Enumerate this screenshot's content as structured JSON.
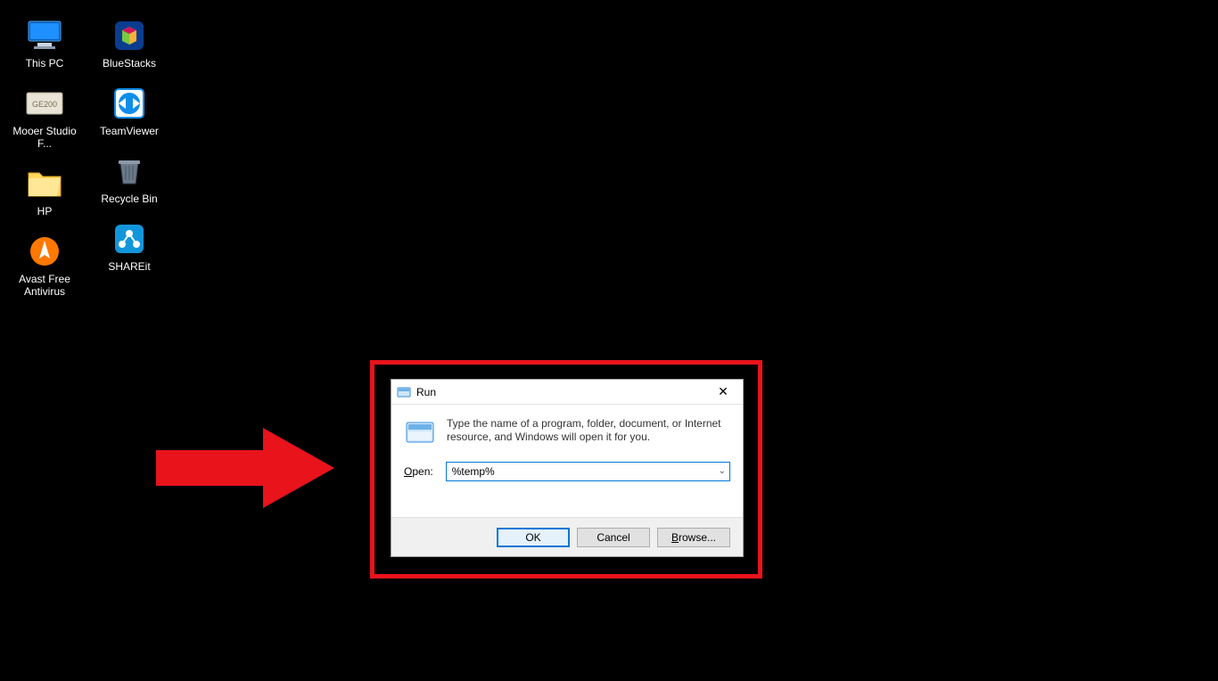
{
  "desktop_icons": {
    "this_pc": "This PC",
    "mooer": "Mooer Studio F...",
    "hp": "HP",
    "avast": "Avast Free Antivirus",
    "bluestacks": "BlueStacks",
    "teamviewer": "TeamViewer",
    "recycle_bin": "Recycle Bin",
    "shareit": "SHAREit"
  },
  "run_dialog": {
    "title": "Run",
    "description": "Type the name of a program, folder, document, or Internet resource, and Windows will open it for you.",
    "open_label": "Open:",
    "open_value": "%temp%",
    "ok_button": "OK",
    "cancel_button": "Cancel",
    "browse_button": "Browse..."
  }
}
